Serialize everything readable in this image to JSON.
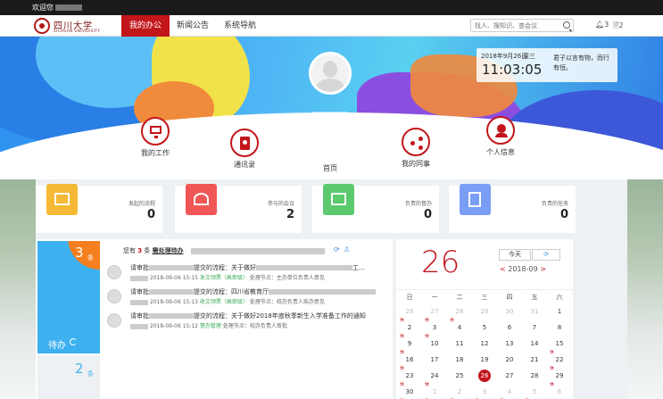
{
  "welcome": {
    "prefix": "欢迎您"
  },
  "logo": {
    "name": "四川大学",
    "sub": "SICHUAN UNIVERSITY"
  },
  "nav": {
    "items": [
      "我的办公",
      "新闻公告",
      "系统导航"
    ]
  },
  "search": {
    "placeholder": "找人、搜知识、查会议"
  },
  "header_badges": {
    "bell": "3",
    "doc": "2"
  },
  "datebox": {
    "date": "2018年9月26日",
    "weekday": "周三",
    "time": "11:03:05",
    "quote": "君子以言有物，而行有恒。"
  },
  "quick": {
    "items": [
      "我的工作",
      "通讯录",
      "首页",
      "我的同事",
      "个人信息"
    ]
  },
  "stats": [
    {
      "title": "发起的流程",
      "value": "0",
      "color": "#f5b935"
    },
    {
      "title": "参与的会议",
      "value": "2",
      "color": "#f05656"
    },
    {
      "title": "负责的督办",
      "value": "0",
      "color": "#5cc96e"
    },
    {
      "title": "负责的任务",
      "value": "0",
      "color": "#7a9ef5"
    }
  ],
  "todo": {
    "count": "3",
    "unit": "条",
    "tab_label": "待办",
    "tab2_count": "2",
    "tab2_unit": "条",
    "head_prefix": "您有",
    "head_count": "3",
    "head_mid": "条",
    "head_link": "需处理待办",
    "rows": [
      {
        "l1a": "请审批",
        "l1b": "提交的流程：关于做好",
        "l1c": "工...",
        "date": "2018-09-06 15:15",
        "tag": "发文领票（高密级）",
        "node": "处理节点：主办单位负责人意见"
      },
      {
        "l1a": "请审批",
        "l1b": "提交的流程：四川省教育厅",
        "l1c": "",
        "date": "2018-09-06 15:13",
        "tag": "收文领票（高密级）",
        "node": "处理节点：校办负责人拟办意见"
      },
      {
        "l1a": "请审批",
        "l1b": "提交的流程：关于做好2018年度秋季新生入学准备工作的通知",
        "l1c": "",
        "date": "2018-09-06 15:12",
        "tag": "督办管理",
        "node": "处理节点：校办负责人审批"
      }
    ]
  },
  "calendar": {
    "big_day": "26",
    "today_label": "今天",
    "refresh": "⟳",
    "month_label": "2018-09",
    "weekdays": [
      "日",
      "一",
      "二",
      "三",
      "四",
      "五",
      "六"
    ],
    "rest_label": "休",
    "weeks": [
      [
        "26",
        "27",
        "28",
        "29",
        "30",
        "31",
        "1"
      ],
      [
        "2",
        "3",
        "4",
        "5",
        "6",
        "7",
        "8"
      ],
      [
        "9",
        "10",
        "11",
        "12",
        "13",
        "14",
        "15"
      ],
      [
        "16",
        "17",
        "18",
        "19",
        "20",
        "21",
        "22"
      ],
      [
        "23",
        "24",
        "25",
        "26",
        "27",
        "28",
        "29"
      ],
      [
        "30",
        "1",
        "2",
        "3",
        "4",
        "5",
        "6"
      ]
    ],
    "muted": [
      [
        0,
        0
      ],
      [
        0,
        1
      ],
      [
        0,
        2
      ],
      [
        0,
        3
      ],
      [
        0,
        4
      ],
      [
        0,
        5
      ],
      [
        5,
        1
      ],
      [
        5,
        2
      ],
      [
        5,
        3
      ],
      [
        5,
        4
      ],
      [
        5,
        5
      ],
      [
        5,
        6
      ]
    ],
    "rest": [
      [
        0,
        0
      ],
      [
        0,
        1
      ],
      [
        0,
        2
      ],
      [
        1,
        0
      ],
      [
        1,
        1
      ],
      [
        2,
        0
      ],
      [
        2,
        6
      ],
      [
        3,
        0
      ],
      [
        3,
        6
      ],
      [
        4,
        0
      ],
      [
        4,
        1
      ],
      [
        4,
        6
      ],
      [
        5,
        0
      ],
      [
        5,
        1
      ],
      [
        5,
        2
      ],
      [
        5,
        3
      ],
      [
        5,
        4
      ],
      [
        5,
        5
      ]
    ],
    "selected": [
      4,
      3
    ]
  }
}
